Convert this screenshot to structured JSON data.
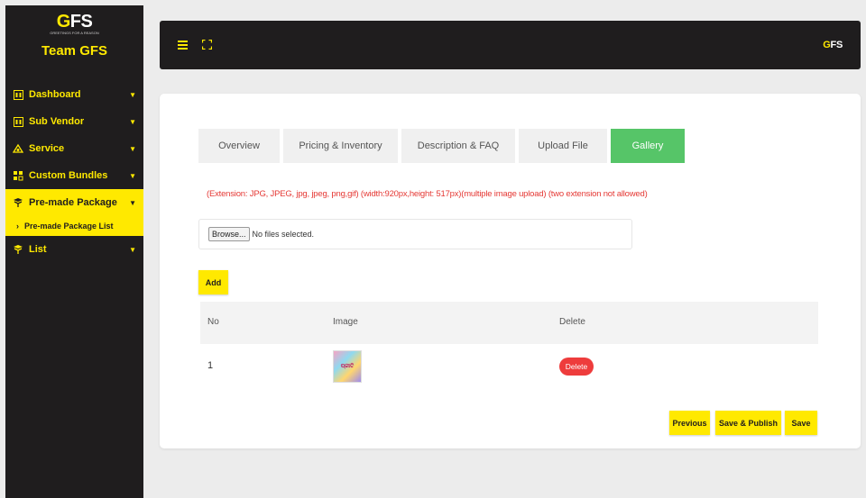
{
  "sidebar": {
    "brand_logo_accent": "G",
    "brand_logo_text": "FS",
    "brand_tagline": "GREETINGS FOR A REASON",
    "brand_name": "Team GFS",
    "items": [
      {
        "label": "Dashboard",
        "icon": "grid-icon"
      },
      {
        "label": "Sub Vendor",
        "icon": "grid-icon"
      },
      {
        "label": "Service",
        "icon": "service-icon"
      },
      {
        "label": "Custom Bundles",
        "icon": "bundles-icon"
      },
      {
        "label": "Pre-made Package",
        "icon": "package-icon",
        "active": true
      },
      {
        "label": "List",
        "icon": "list-icon"
      }
    ],
    "sub_items": [
      {
        "label": "Pre-made Package List"
      }
    ]
  },
  "topbar": {
    "menu_icon": "hamburger-icon",
    "fullscreen_icon": "expand-icon",
    "logo_accent": "G",
    "logo_text": "FS"
  },
  "tabs": [
    {
      "label": "Overview"
    },
    {
      "label": "Pricing & Inventory"
    },
    {
      "label": "Description & FAQ"
    },
    {
      "label": "Upload File"
    },
    {
      "label": "Gallery",
      "active": true
    }
  ],
  "note": "(Extension: JPG, JPEG, jpg, jpeg, png,gif) (width:920px,height: 517px)(multiple image upload) (two extension not allowed)",
  "file_input": {
    "browse_label": "Browse...",
    "status": "No files selected."
  },
  "add_label": "Add",
  "table": {
    "headers": [
      "No",
      "Image",
      "Delete"
    ],
    "rows": [
      {
        "no": "1",
        "image_text": "ପ୍ରୀତି",
        "delete_label": "Delete"
      }
    ]
  },
  "actions": {
    "previous": "Previous",
    "save_publish": "Save & Publish",
    "save": "Save"
  },
  "colors": {
    "accent": "#ffe900",
    "dark": "#1f1d1e",
    "active_tab": "#56c568",
    "danger": "#ee3c3c"
  }
}
